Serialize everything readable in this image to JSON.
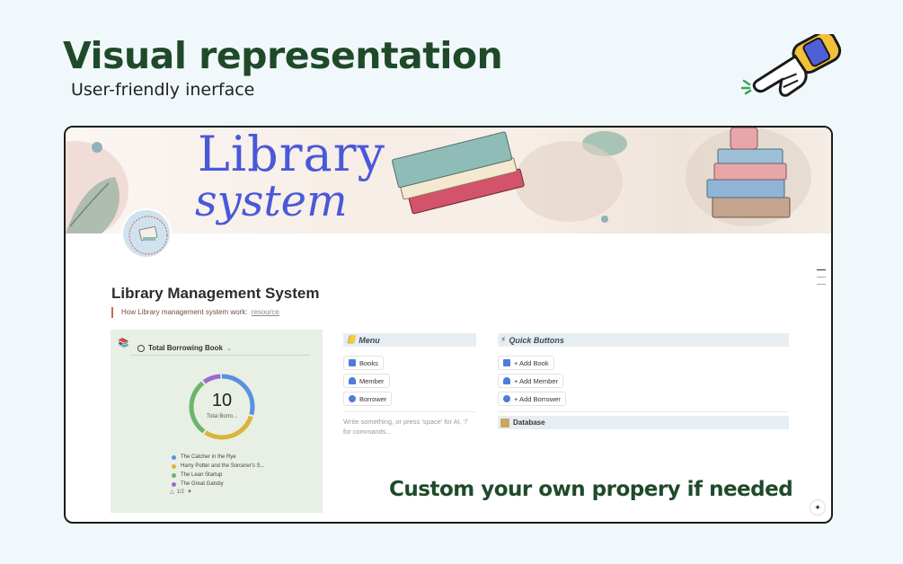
{
  "promo": {
    "title": "Visual representation",
    "subtitle": "User-friendly inerface",
    "footer_text": "Custom your own propery if needed"
  },
  "cover": {
    "title_line1": "Library",
    "title_line2": "system"
  },
  "page": {
    "title": "Library Management System",
    "callout_text": "How Library management system work:",
    "callout_link": "resource"
  },
  "chart_panel": {
    "heading": "Total Borrowing Book",
    "center_value": "10",
    "center_label": "Total Borro...",
    "pager": "1/2"
  },
  "chart_data": {
    "type": "pie",
    "categories": [
      "The Catcher in the Rye",
      "Harry Potter and the Sorcerer's S...",
      "The Lean Startup",
      "The Great Gatsby"
    ],
    "colors": [
      "#5b8fe0",
      "#d8b53a",
      "#6ab56a",
      "#9b6bd0"
    ],
    "values": [
      3,
      3,
      3,
      1
    ],
    "total": 10,
    "legend_position": "bottom"
  },
  "menu": {
    "heading": "Menu",
    "items": [
      {
        "label": "Books",
        "icon": "book-icon",
        "color": "#4f7bd9"
      },
      {
        "label": "Member",
        "icon": "person-icon",
        "color": "#4f7bd9"
      },
      {
        "label": "Borrower",
        "icon": "person-pin-icon",
        "color": "#4f7bd9"
      }
    ],
    "placeholder": "Write something, or press 'space' for AI, '/' for commands..."
  },
  "quick_buttons": {
    "heading": "Quick Buttons",
    "items": [
      {
        "label": "+ Add Book",
        "icon": "book-icon"
      },
      {
        "label": "+ Add Member",
        "icon": "person-icon"
      },
      {
        "label": "+ Add Borrower",
        "icon": "person-pin-icon"
      }
    ],
    "database_label": "Database"
  },
  "colors": {
    "accent_green": "#1f4a2a",
    "cover_blue": "#4a58d8",
    "panel_bg": "#e8efe4"
  }
}
